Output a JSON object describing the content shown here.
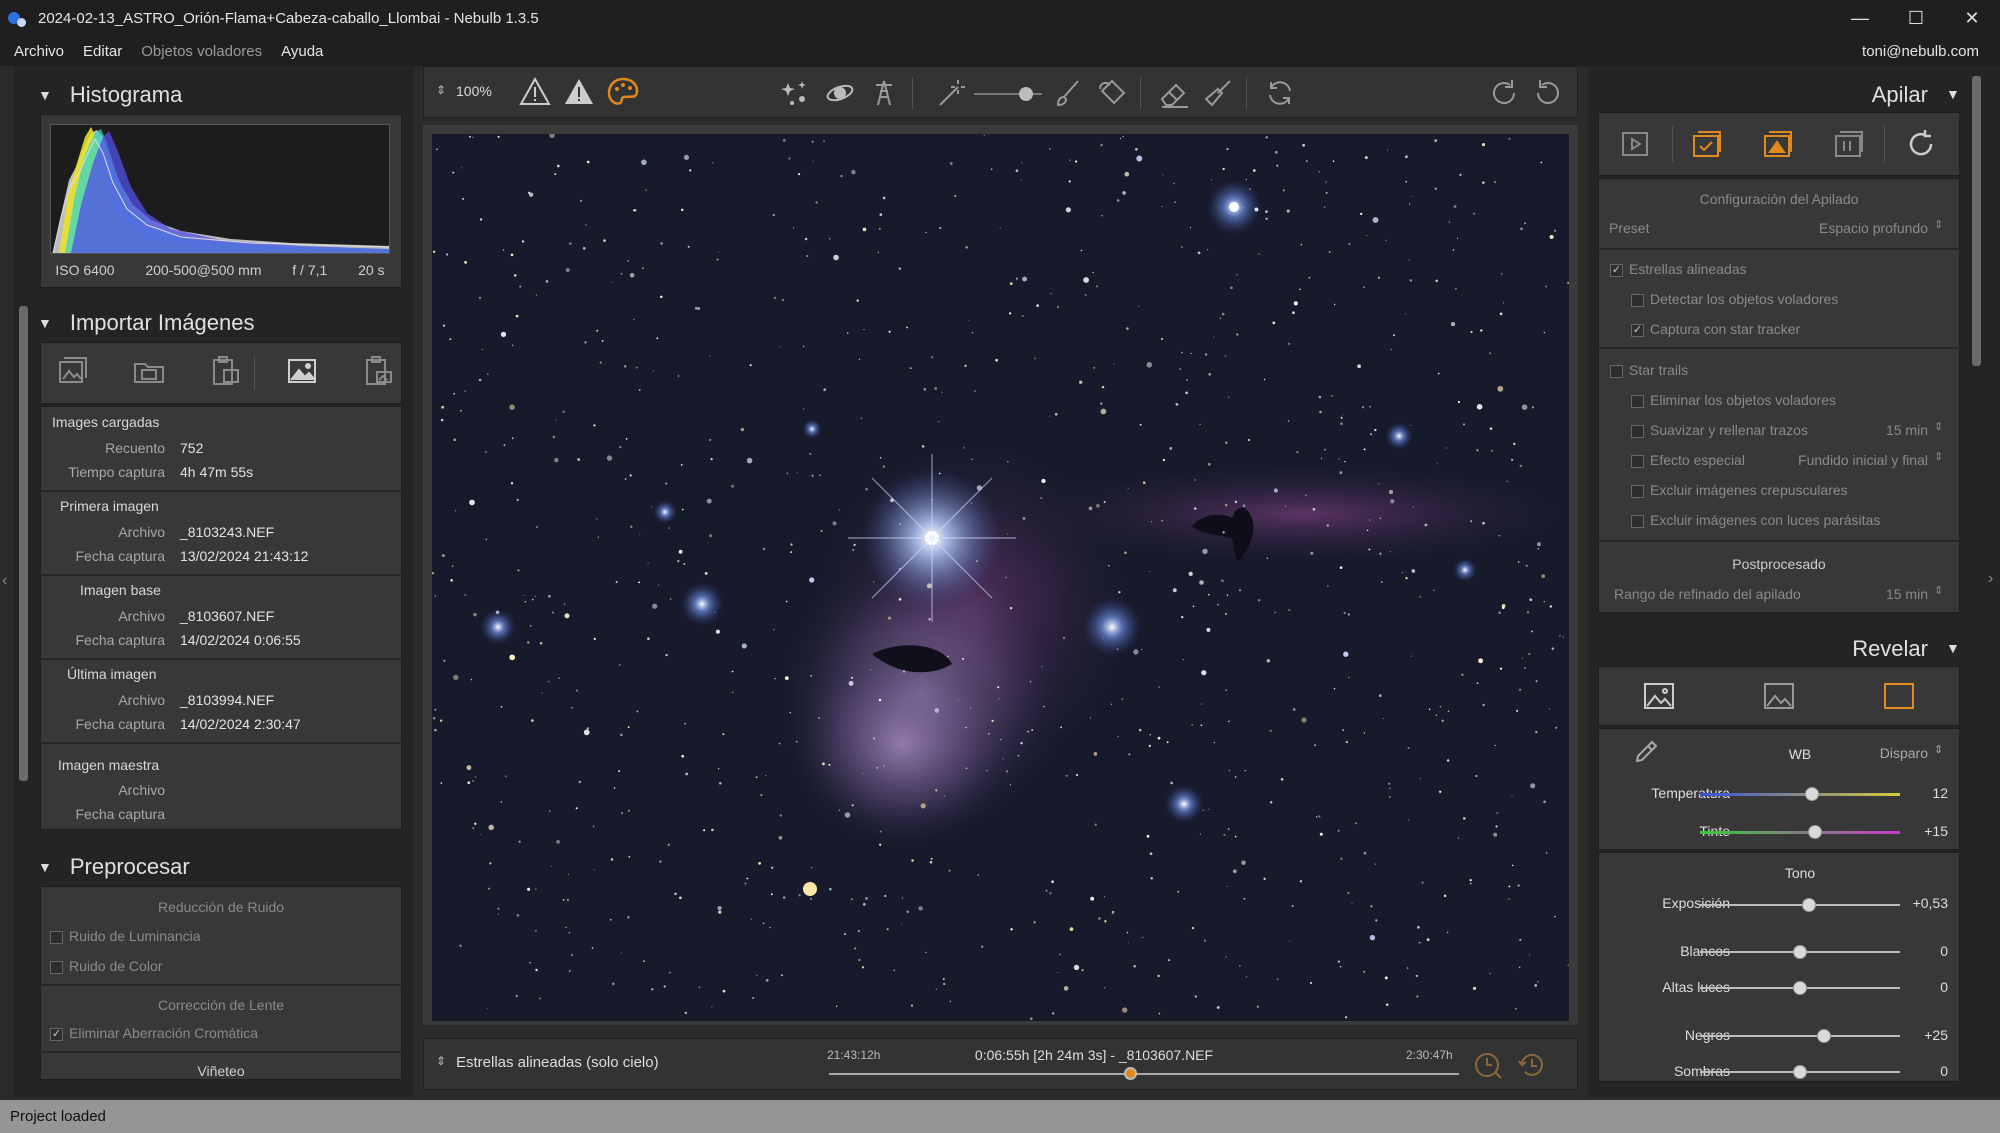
{
  "window": {
    "title": "2024-02-13_ASTRO_Orión-Flama+Cabeza-caballo_Llombai - Nebulb 1.3.5",
    "buttons": [
      "—",
      "☐",
      "✕"
    ]
  },
  "menu": {
    "items": [
      "Archivo",
      "Editar",
      "Objetos voladores",
      "Ayuda"
    ],
    "user": "toni@nebulb.com"
  },
  "histogram": {
    "title": "Histograma",
    "iso": "ISO 6400",
    "lens": "200-500@500 mm",
    "aperture": "f / 7,1",
    "exposure": "20 s"
  },
  "import": {
    "title": "Importar Imágenes",
    "loaded": {
      "heading": "Images cargadas",
      "count_label": "Recuento",
      "count": "752",
      "time_label": "Tiempo captura",
      "time": "4h 47m 55s"
    },
    "first": {
      "heading": "Primera imagen",
      "file_label": "Archivo",
      "file": "_8103243.NEF",
      "date_label": "Fecha captura",
      "date": "13/02/2024 21:43:12"
    },
    "base": {
      "heading": "Imagen base",
      "file_label": "Archivo",
      "file": "_8103607.NEF",
      "date_label": "Fecha captura",
      "date": "14/02/2024 0:06:55"
    },
    "last": {
      "heading": "Última imagen",
      "file_label": "Archivo",
      "file": "_8103994.NEF",
      "date_label": "Fecha captura",
      "date": "14/02/2024 2:30:47"
    },
    "master": {
      "heading": "Imagen maestra",
      "file_label": "Archivo",
      "date_label": "Fecha captura"
    }
  },
  "preprocess": {
    "title": "Preprocesar",
    "noise_heading": "Reducción de Ruido",
    "luminance": "Ruido de Luminancia",
    "color": "Ruido de Color",
    "lens_heading": "Corrección de Lente",
    "chromatic": "Eliminar Aberración Cromática",
    "vignette": "Viñeteo"
  },
  "toolbar": {
    "zoom": "100%"
  },
  "bottom": {
    "mode": "Estrellas alineadas (solo cielo)",
    "start_time": "21:43:12h",
    "current": "0:06:55h [2h 24m 3s] - _8103607.NEF",
    "end_time": "2:30:47h",
    "timeline_position": 0.48
  },
  "stack": {
    "title": "Apilar",
    "config_heading": "Configuración del Apilado",
    "preset_label": "Preset",
    "preset_value": "Espacio profundo",
    "aligned": "Estrellas alineadas",
    "detect_flying": "Detectar los objetos voladores",
    "star_tracker": "Captura con star tracker",
    "star_trails": "Star trails",
    "remove_flying": "Eliminar los objetos voladores",
    "smooth": "Suavizar y rellenar trazos",
    "smooth_value": "15 min",
    "special": "Efecto especial",
    "special_value": "Fundido inicial y final",
    "exclude_twilight": "Excluir imágenes crepusculares",
    "exclude_lights": "Excluir imágenes con luces parásitas",
    "post_heading": "Postprocesado",
    "refine_label": "Rango de refinado del apilado",
    "refine_value": "15 min"
  },
  "develop": {
    "title": "Revelar",
    "wb_label": "WB",
    "wb_value": "Disparo",
    "temperature_label": "Temperatura",
    "temperature_value": "12",
    "tint_label": "Tinte",
    "tint_value": "+15",
    "tone_heading": "Tono",
    "exposure_label": "Exposición",
    "exposure_value": "+0,53",
    "whites_label": "Blancos",
    "whites_value": "0",
    "highlights_label": "Altas luces",
    "highlights_value": "0",
    "blacks_label": "Negros",
    "blacks_value": "+25",
    "shadows_label": "Sombras",
    "shadows_value": "0"
  },
  "status": {
    "text": "Project loaded"
  },
  "colors": {
    "accent": "#e08a1e",
    "panel": "#383838",
    "background": "#242424"
  }
}
